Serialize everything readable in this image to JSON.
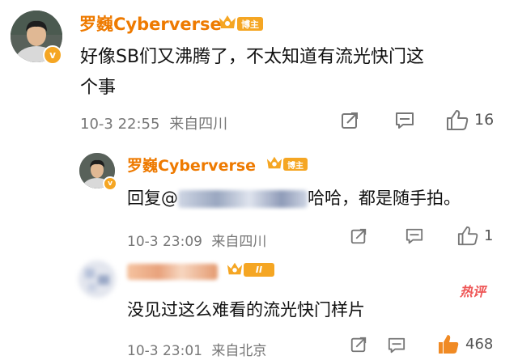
{
  "comments": [
    {
      "username": "罗巍Cyberverse",
      "badge": "博主",
      "verified_mark": "v",
      "text_lines": [
        "好像SB们又沸腾了，不太知道有流光快门这",
        "个事"
      ],
      "time": "10-3 22:55",
      "location": "来自四川",
      "likes": "16",
      "icons": [
        "share-icon",
        "comment-icon",
        "like-icon"
      ]
    },
    {
      "username": "罗巍Cyberverse",
      "badge": "博主",
      "reply_prefix": "回复@",
      "reply_suffix": "哈哈，都是随手拍。",
      "time": "10-3 23:09",
      "location": "来自四川",
      "likes": "1",
      "icons": [
        "share-icon",
        "comment-icon",
        "like-icon"
      ]
    },
    {
      "fan_level": "II",
      "text": "没见过这么难看的流光快门样片",
      "hot_label": "热评",
      "time": "10-3 23:01",
      "location": "来自北京",
      "likes": "468",
      "icons": [
        "share-icon",
        "comment-icon",
        "like-icon-filled"
      ]
    }
  ],
  "colors": {
    "username": "#ee7a00",
    "badge_bg": "#f5a623",
    "meta_text": "#777777",
    "like_active": "#f08a24",
    "hot_label": "#e55555"
  }
}
